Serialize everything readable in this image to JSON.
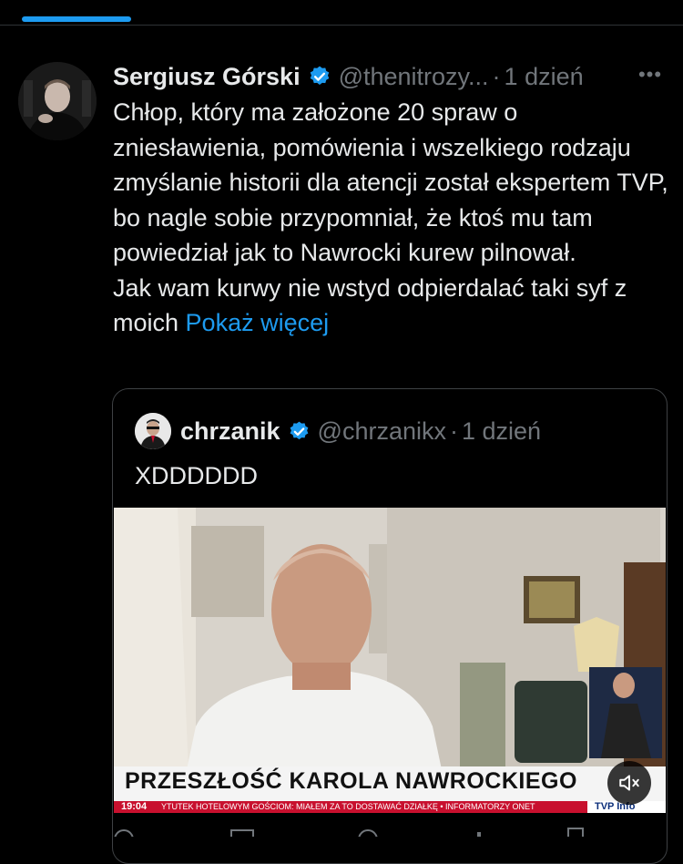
{
  "tweet": {
    "display_name": "Sergiusz Górski",
    "handle": "@thenitrozy...",
    "separator": "·",
    "time": "1 dzień",
    "paragraphs": [
      "Chłop, który ma założone 20 spraw o zniesławienia, pomówienia i wszelkiego rodzaju zmyślanie historii dla atencji został ekspertem TVP, bo nagle sobie przypomniał, że ktoś mu tam powiedział jak to Nawrocki kurew pilnował.",
      "Jak wam kurwy nie wstyd odpierdalać taki syf z moich"
    ],
    "show_more": "Pokaż więcej",
    "more_label": "•••"
  },
  "quote": {
    "display_name": "chrzanik",
    "handle": "@chrzanikx",
    "separator": "·",
    "time": "1 dzień",
    "text": "XDDDDDD"
  },
  "media": {
    "chyron": "PRZESZŁOŚĆ KAROLA NAWROCKIEGO",
    "ticker_clock": "19:04",
    "ticker_text": "YTUTEK HOTELOWYM GOŚCIOM: MIAŁEM ZA TO DOSTAWAĆ DZIAŁKĘ • INFORMATORZY ONET",
    "channel": "TVP Info"
  },
  "colors": {
    "accent": "#1d9bf0",
    "background": "#000000",
    "text": "#e7e9ea",
    "muted": "#71767b",
    "chyron_red": "#c8102e"
  },
  "icons": [
    "verified-badge-icon",
    "more-options-icon",
    "mute-icon",
    "reply-icon",
    "retweet-icon",
    "like-icon",
    "views-icon",
    "share-icon"
  ]
}
